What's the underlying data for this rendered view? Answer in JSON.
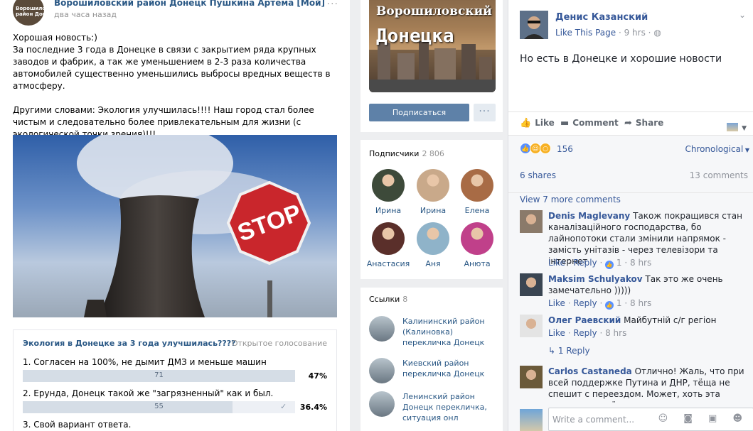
{
  "vk_post": {
    "author": "Ворошиловский район Донецк Пушкина Артёма [Мой]",
    "avatar_text": "Ворошиловский район Донецка",
    "time": "два часа назад",
    "more": "···",
    "paragraphs": [
      "Хорошая новость:)\nЗа последние 3 года в Донецке в связи с закрытием ряда крупных заводов и фабрик, а так же уменьшением в 2-3 раза количества автомобилей существенно уменьшились выбросы вредных веществ в атмосферу.",
      "Другими словами: Экология улучшилась!!!! Наш город стал более чистым и следовательно более привлекательным для жизни (с экологической точки зрения)!!!"
    ],
    "photo_sign": "STOP"
  },
  "poll": {
    "title": "Экология в Донецке за 3 года улучшилась????",
    "kind": "Открытое голосование",
    "options": [
      {
        "label": "1. Согласен на 100%, не дымит ДМЗ и меньше машин",
        "count": "71",
        "pct": "47%",
        "fraction": 1.0,
        "checked": false
      },
      {
        "label": "2. Ерунда, Донецк такой же \"загрязненный\" как и был.",
        "count": "55",
        "pct": "36.4%",
        "fraction": 0.77,
        "checked": true
      },
      {
        "label": "3. Свой вариант ответа.",
        "count": "",
        "pct": "",
        "fraction": 0,
        "checked": false
      }
    ]
  },
  "vk_group": {
    "cover_line1": "Ворошиловский район",
    "cover_line2": "Донецка",
    "subscribe_label": "Подписаться",
    "more_label": "···",
    "members_title": "Подписчики",
    "members_count": "2 806",
    "members": [
      {
        "name": "Ирина",
        "color": "#3d4a3a"
      },
      {
        "name": "Ирина",
        "color": "#c9a98a"
      },
      {
        "name": "Елена",
        "color": "#a86b45"
      },
      {
        "name": "Анастасия",
        "color": "#5a2f2a"
      },
      {
        "name": "Аня",
        "color": "#8fb3c9"
      },
      {
        "name": "Анюта",
        "color": "#c0408a"
      }
    ],
    "links_title": "Ссылки",
    "links_count": "8",
    "links": [
      {
        "text": "Калининский район (Калиновка) перекличка Донецк"
      },
      {
        "text": "Киевский район перекличка Донецк"
      },
      {
        "text": "Ленинский район Донецк перекличка, ситуация онл"
      }
    ]
  },
  "fb": {
    "page_name": "Денис Казанский",
    "like_page": "Like This Page",
    "time": "9 hrs",
    "globe": "◍",
    "chevron": "⌄",
    "post_text": "Но есть в Донецке и хорошие новости",
    "actions": {
      "like": "Like",
      "comment": "Comment",
      "share": "Share",
      "like_icon": "👍",
      "comment_icon": "▬",
      "share_icon": "➦"
    },
    "reactions_count": "156",
    "chronological": "Chronological",
    "shares": "6 shares",
    "comments_count": "13 comments",
    "view_more": "View 7 more comments",
    "comments": [
      {
        "name": "Denis Maglevany",
        "text": "Також покращився стан каналізаційного господарства, бо лайнопотоки стали змінили напрямок - замість унітазів - через телевізори та інтернет",
        "like": "Like",
        "reply": "Reply",
        "likes": "1",
        "time": "8 hrs",
        "ava": "#8a7a6a"
      },
      {
        "name": "Maksim Schulyakov",
        "text": "Так это же очень замечательно )))))",
        "like": "Like",
        "reply": "Reply",
        "likes": "1",
        "time": "8 hrs",
        "ava": "#3a4552"
      },
      {
        "name": "Олег Раевский",
        "text": "Майбутній с/г регіон",
        "like": "Like",
        "reply": "Reply",
        "likes": "",
        "time": "8 hrs",
        "ava": "#e4e4e4"
      },
      {
        "name": "Carlos Castaneda",
        "text": "Отлично! Жаль, что при всей поддержке Путина и ДНР, тёща не спешит с переездом. Может, хоть эта новость на неё",
        "like": "",
        "reply": "",
        "likes": "",
        "time": "",
        "ava": "#6b5a3a"
      }
    ],
    "reply_link": "1 Reply",
    "reply_icon": "↳",
    "write_placeholder": "Write a comment...",
    "write_icons": "☺ ◙ ▣ ☻"
  }
}
